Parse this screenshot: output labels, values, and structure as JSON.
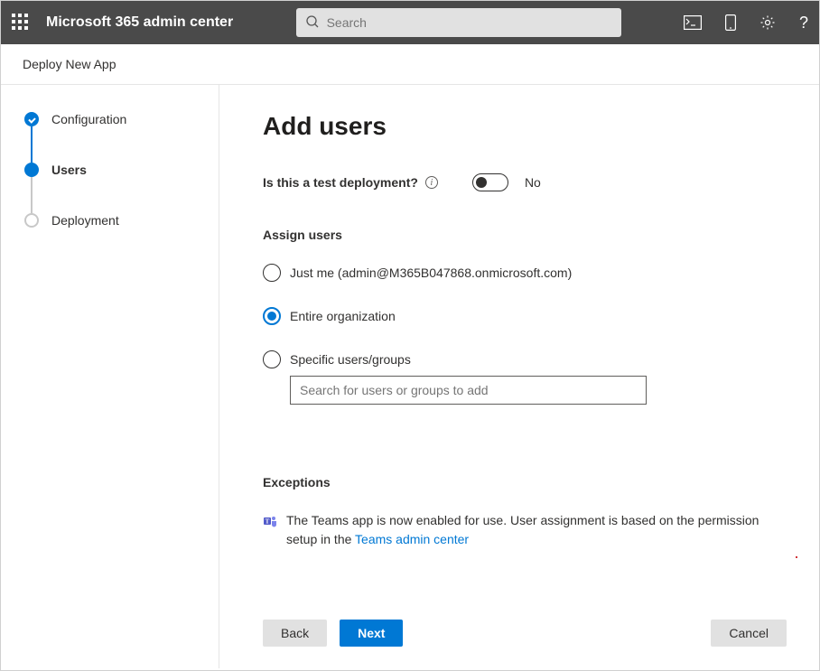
{
  "header": {
    "app_title": "Microsoft 365 admin center",
    "search_placeholder": "Search"
  },
  "page": {
    "subheader": "Deploy New App",
    "title": "Add users"
  },
  "steps": [
    {
      "label": "Configuration",
      "state": "completed"
    },
    {
      "label": "Users",
      "state": "active"
    },
    {
      "label": "Deployment",
      "state": "pending"
    }
  ],
  "test_deployment": {
    "question": "Is this a test deployment?",
    "value_label": "No"
  },
  "assign": {
    "section_label": "Assign users",
    "options": [
      {
        "key": "just_me",
        "label": "Just me (admin@M365B047868.onmicrosoft.com)",
        "selected": false
      },
      {
        "key": "entire_org",
        "label": "Entire organization",
        "selected": true
      },
      {
        "key": "specific",
        "label": "Specific users/groups",
        "selected": false
      }
    ],
    "search_placeholder": "Search for users or groups to add"
  },
  "exceptions": {
    "section_label": "Exceptions",
    "text_before": "The Teams app is now enabled for use. User assignment is based on the permission setup in the ",
    "link_text": "Teams admin center"
  },
  "buttons": {
    "back": "Back",
    "next": "Next",
    "cancel": "Cancel"
  }
}
